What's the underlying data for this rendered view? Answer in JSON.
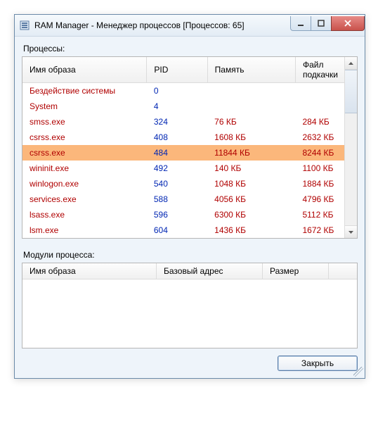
{
  "title": "RAM Manager - Менеджер процессов [Процессов: 65]",
  "labels": {
    "processes": "Процессы:",
    "modules": "Модули процесса:"
  },
  "columns": {
    "name": "Имя образа",
    "pid": "PID",
    "memory": "Память",
    "pagefile": "Файл подкачки"
  },
  "moduleColumns": {
    "name": "Имя образа",
    "base": "Базовый адрес",
    "size": "Размер"
  },
  "processes": [
    {
      "name": "Бездействие системы",
      "pid": "0",
      "memory": "",
      "pagefile": "",
      "selected": false
    },
    {
      "name": "System",
      "pid": "4",
      "memory": "",
      "pagefile": "",
      "selected": false
    },
    {
      "name": "smss.exe",
      "pid": "324",
      "memory": "76 КБ",
      "pagefile": "284 КБ",
      "selected": false
    },
    {
      "name": "csrss.exe",
      "pid": "408",
      "memory": "1608 КБ",
      "pagefile": "2632 КБ",
      "selected": false
    },
    {
      "name": "csrss.exe",
      "pid": "484",
      "memory": "11844 КБ",
      "pagefile": "8244 КБ",
      "selected": true
    },
    {
      "name": "wininit.exe",
      "pid": "492",
      "memory": "140 КБ",
      "pagefile": "1100 КБ",
      "selected": false
    },
    {
      "name": "winlogon.exe",
      "pid": "540",
      "memory": "1048 КБ",
      "pagefile": "1884 КБ",
      "selected": false
    },
    {
      "name": "services.exe",
      "pid": "588",
      "memory": "4056 КБ",
      "pagefile": "4796 КБ",
      "selected": false
    },
    {
      "name": "lsass.exe",
      "pid": "596",
      "memory": "6300 КБ",
      "pagefile": "5112 КБ",
      "selected": false
    },
    {
      "name": "lsm.exe",
      "pid": "604",
      "memory": "1436 КБ",
      "pagefile": "1672 КБ",
      "selected": false
    }
  ],
  "buttons": {
    "close": "Закрыть"
  }
}
